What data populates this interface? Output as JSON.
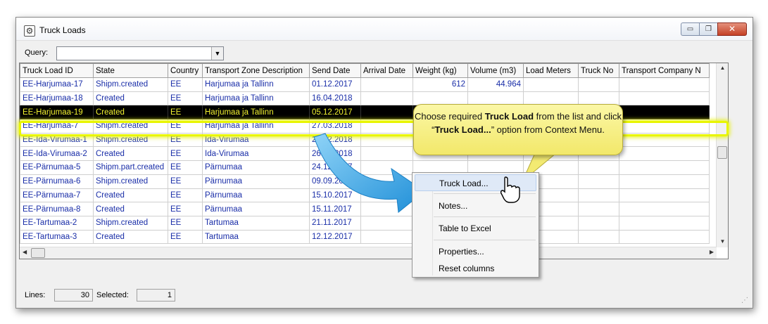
{
  "window": {
    "title": "Truck Loads",
    "icon": "truck-loads-app-icon",
    "controls": {
      "minimize": "▭",
      "maximize": "❐",
      "close": "✕"
    }
  },
  "query": {
    "label": "Query:",
    "value": ""
  },
  "table": {
    "columns": [
      "Truck Load ID",
      "State",
      "Country",
      "Transport Zone Description",
      "Send Date",
      "Arrival Date",
      "Weight (kg)",
      "Volume (m3)",
      "Load Meters",
      "Truck No",
      "Transport Company N"
    ],
    "rows": [
      [
        "EE-Harjumaa-17",
        "Shipm.created",
        "EE",
        "Harjumaa ja Tallinn",
        "01.12.2017",
        "",
        "612",
        "44.964",
        "",
        "",
        ""
      ],
      [
        "EE-Harjumaa-18",
        "Created",
        "EE",
        "Harjumaa ja Tallinn",
        "16.04.2018",
        "",
        "",
        "",
        "",
        "",
        ""
      ],
      [
        "EE-Harjumaa-19",
        "Created",
        "EE",
        "Harjumaa ja Tallinn",
        "05.12.2017",
        "",
        "",
        "",
        "",
        "",
        ""
      ],
      [
        "EE-Harjumaa-7",
        "Shipm.created",
        "EE",
        "Harjumaa ja Tallinn",
        "27.03.2018",
        "",
        "",
        "",
        "",
        "",
        ""
      ],
      [
        "EE-Ida-Virumaa-1",
        "Shipm.created",
        "EE",
        "Ida-Virumaa",
        "22.02.2018",
        "",
        "",
        "",
        "",
        "",
        ""
      ],
      [
        "EE-Ida-Virumaa-2",
        "Created",
        "EE",
        "Ida-Virumaa",
        "26.02.2018",
        "",
        "",
        "",
        "",
        "",
        ""
      ],
      [
        "EE-Pärnumaa-5",
        "Shipm.part.created",
        "EE",
        "Pärnumaa",
        "24.12.2017",
        "",
        "",
        "",
        "",
        "",
        ""
      ],
      [
        "EE-Pärnumaa-6",
        "Shipm.created",
        "EE",
        "Pärnumaa",
        "09.09.2017",
        "",
        "",
        "",
        "",
        "",
        ""
      ],
      [
        "EE-Pärnumaa-7",
        "Created",
        "EE",
        "Pärnumaa",
        "15.10.2017",
        "",
        "",
        "",
        "",
        "",
        ""
      ],
      [
        "EE-Pärnumaa-8",
        "Created",
        "EE",
        "Pärnumaa",
        "15.11.2017",
        "",
        "",
        "",
        "",
        "",
        ""
      ],
      [
        "EE-Tartumaa-2",
        "Shipm.created",
        "EE",
        "Tartumaa",
        "21.11.2017",
        "",
        "",
        "",
        "",
        "",
        ""
      ],
      [
        "EE-Tartumaa-3",
        "Created",
        "EE",
        "Tartumaa",
        "12.12.2017",
        "",
        "",
        "",
        "",
        "",
        ""
      ]
    ],
    "selected_row": 2
  },
  "status": {
    "lines_label": "Lines:",
    "lines_value": "30",
    "selected_label": "Selected:",
    "selected_value": "1"
  },
  "context_menu": {
    "items": [
      {
        "label": "Truck Load...",
        "hover": true
      },
      {
        "label": "Notes..."
      },
      {
        "label": "Table to Excel"
      },
      {
        "label": "Properties..."
      },
      {
        "label": "Reset columns"
      }
    ]
  },
  "callout": {
    "part1": "Choose required ",
    "bold1": "Truck Load",
    "part2": " from the list and click “",
    "bold2": "Truck Load...",
    "part3": "” option from Context Menu."
  },
  "colors": {
    "row_text": "#1a2ea8",
    "selected_bg": "#000000",
    "selected_text": "#f2f230",
    "callout": "#f5ee7e",
    "arrow": "#3aa7e6"
  }
}
